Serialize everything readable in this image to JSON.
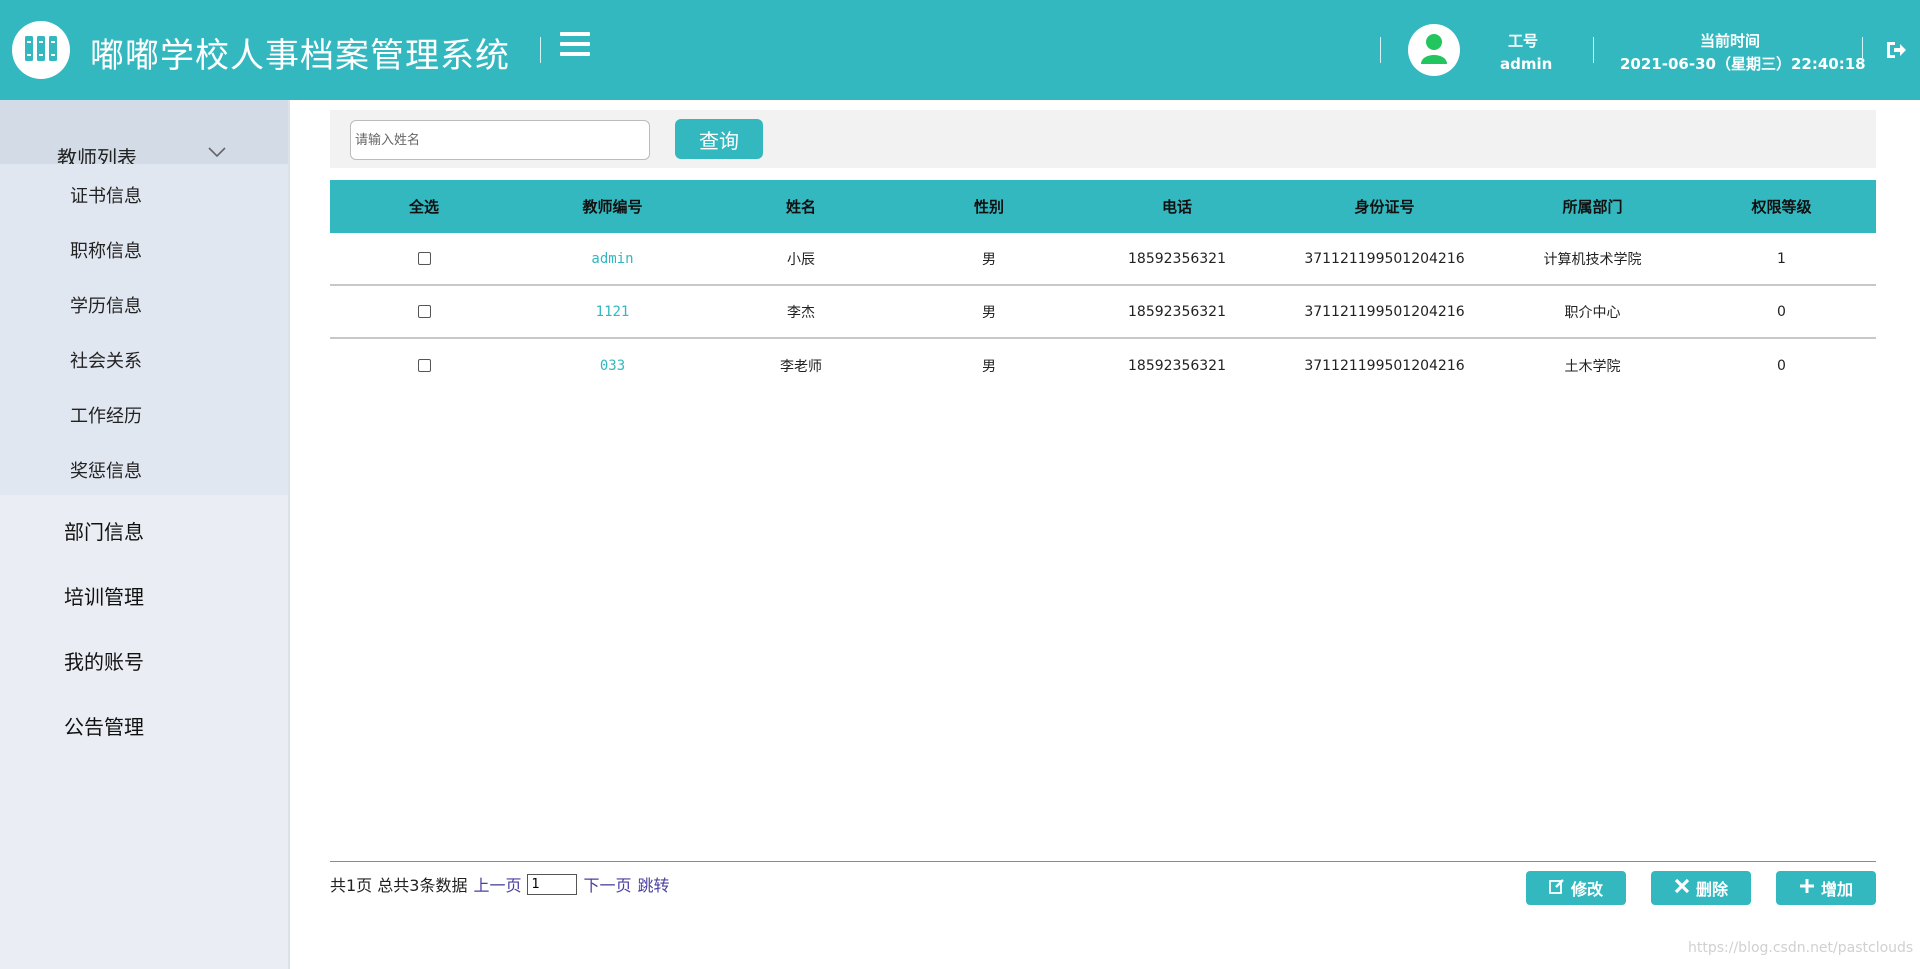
{
  "header": {
    "title": "嘟嘟学校人事档案管理系统",
    "user_label": "工号",
    "user_value": "admin",
    "time_label": "当前时间",
    "time_value": "2021-06-30（星期三）22:40:18",
    "icons": {
      "logo": "books-icon",
      "menu": "menu-icon",
      "avatar": "user-icon",
      "logout": "logout-icon"
    },
    "colors": {
      "accent": "#33b8c0",
      "avatar": "#22c55e"
    }
  },
  "sidebar": {
    "group_label": "教师列表",
    "sub_items": [
      {
        "label": "证书信息"
      },
      {
        "label": "职称信息"
      },
      {
        "label": "学历信息"
      },
      {
        "label": "社会关系"
      },
      {
        "label": "工作经历"
      },
      {
        "label": "奖惩信息"
      }
    ],
    "items": [
      {
        "label": "部门信息"
      },
      {
        "label": "培训管理"
      },
      {
        "label": "我的账号"
      },
      {
        "label": "公告管理"
      }
    ]
  },
  "search": {
    "placeholder": "请输入姓名",
    "value": "",
    "button_label": "查询"
  },
  "table": {
    "headers": [
      "全选",
      "教师编号",
      "姓名",
      "性别",
      "电话",
      "身份证号",
      "所属部门",
      "权限等级"
    ],
    "rows": [
      {
        "id": "admin",
        "name": "小辰",
        "gender": "男",
        "phone": "18592356321",
        "idcard": "371121199501204216",
        "dept": "计算机技术学院",
        "level": "1"
      },
      {
        "id": "1121",
        "name": "李杰",
        "gender": "男",
        "phone": "18592356321",
        "idcard": "371121199501204216",
        "dept": "职介中心",
        "level": "0"
      },
      {
        "id": "033",
        "name": "李老师",
        "gender": "男",
        "phone": "18592356321",
        "idcard": "371121199501204216",
        "dept": "土木学院",
        "level": "0"
      }
    ]
  },
  "pager": {
    "summary": "共1页 总共3条数据",
    "prev": "上一页",
    "page_value": "1",
    "next": "下一页",
    "jump": "跳转"
  },
  "actions": {
    "edit": "修改",
    "delete": "删除",
    "add": "增加"
  },
  "watermark": "https://blog.csdn.net/pastclouds"
}
